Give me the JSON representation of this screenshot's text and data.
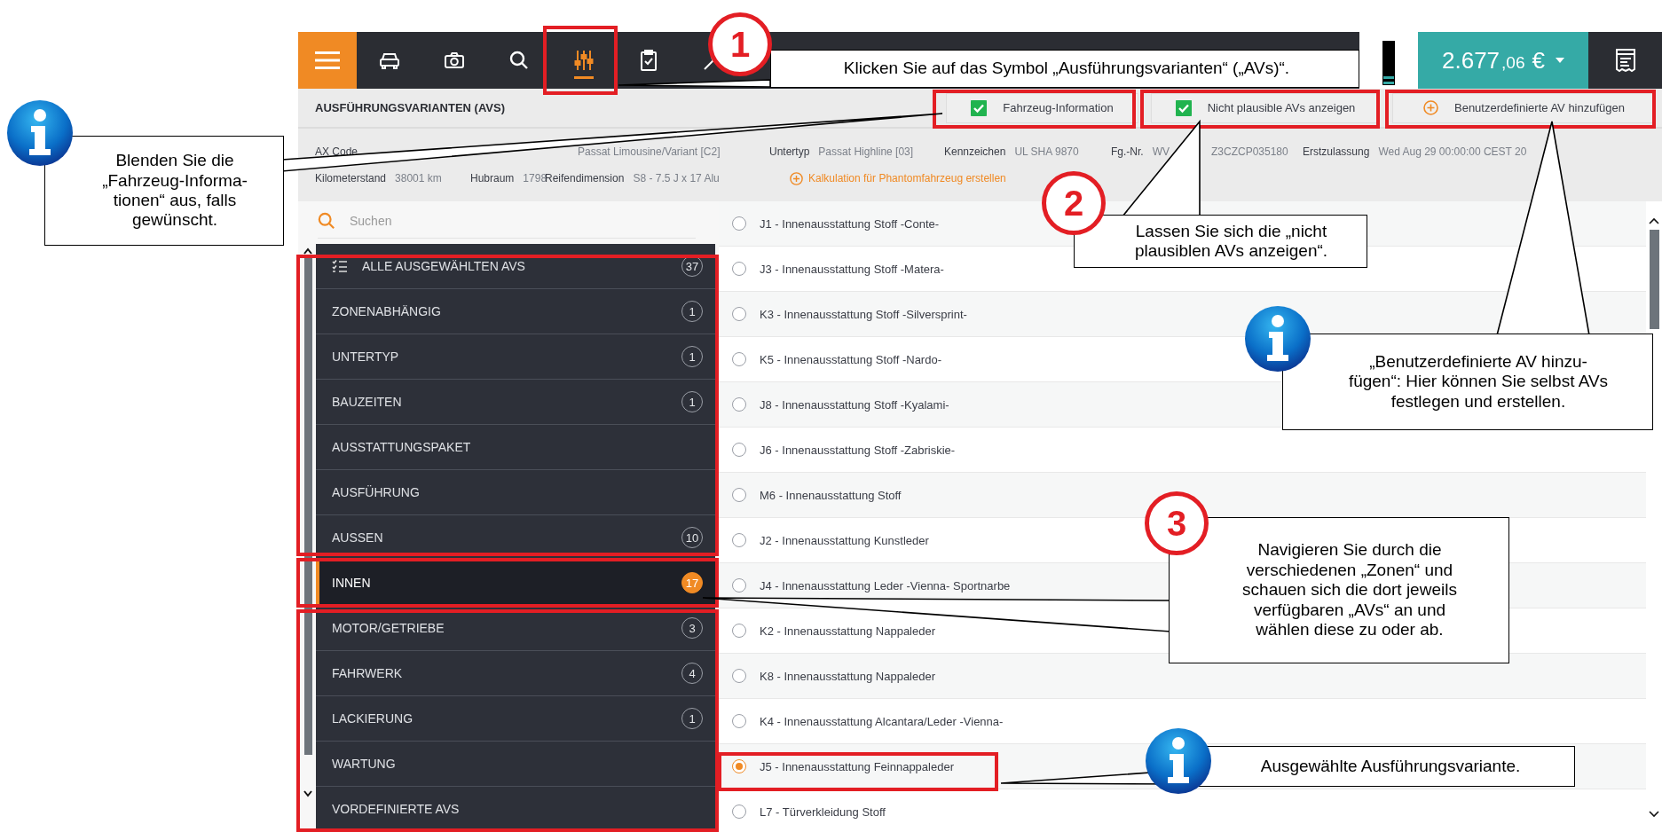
{
  "toolbar": {
    "tabs": [
      {
        "selected": false
      },
      {
        "selected": false
      },
      {
        "selected": false
      },
      {
        "selected": true
      },
      {
        "selected": false
      },
      {
        "selected": false
      }
    ],
    "total": {
      "amount": "2.677",
      "cents": ",06",
      "currency": "€"
    }
  },
  "page_title": "AUSFÜHRUNGSVARIANTEN (AVS)",
  "toggles": [
    {
      "kind": "checkbox",
      "label": "Fahrzeug-Information",
      "checked": true
    },
    {
      "kind": "checkbox",
      "label": "Nicht plausible AVs anzeigen",
      "checked": true
    },
    {
      "kind": "action",
      "label": "Benutzerdefinierte AV hinzufügen"
    }
  ],
  "vehicle_info": {
    "row_1": [
      {
        "label": "AX Code"
      },
      {
        "value": "Passat Limousine/Variant [C2]"
      },
      {
        "label": "Untertyp",
        "value": "Passat Highline [03]"
      },
      {
        "label": "Kennzeichen",
        "value": "UL SHA 9870"
      },
      {
        "label": "Fg.-Nr.",
        "value": "WV"
      },
      {
        "value": "Z3CZCP035180"
      },
      {
        "label": "Erstzulassung",
        "value": "Wed Aug 29 00:00:00 CEST 20"
      }
    ],
    "row_2": [
      {
        "label": "Kilometerstand",
        "value": "38001 km"
      },
      {
        "label": "Hubraum",
        "value": "1798"
      },
      {
        "label": "Reifendimension",
        "value": "S8 - 7.5 J x 17 Alu"
      }
    ],
    "link": "Kalkulation für Phantomfahrzeug erstellen"
  },
  "search": {
    "placeholder": "Suchen"
  },
  "zones": [
    {
      "label": "ALLE AUSGEWÄHLTEN AVS",
      "count": "37",
      "selected": false
    },
    {
      "label": "ZONENABHÄNGIG",
      "count": "1",
      "selected": false
    },
    {
      "label": "UNTERTYP",
      "count": "1",
      "selected": false
    },
    {
      "label": "BAUZEITEN",
      "count": "1",
      "selected": false
    },
    {
      "label": "AUSSTATTUNGSPAKET",
      "selected": false
    },
    {
      "label": "AUSFÜHRUNG",
      "selected": false
    },
    {
      "label": "AUSSEN",
      "count": "10",
      "selected": false
    },
    {
      "label": "INNEN",
      "count": "17",
      "selected": true
    },
    {
      "label": "MOTOR/GETRIEBE",
      "count": "3",
      "selected": false
    },
    {
      "label": "FAHRWERK",
      "count": "4",
      "selected": false
    },
    {
      "label": "LACKIERUNG",
      "count": "1",
      "selected": false
    },
    {
      "label": "WARTUNG",
      "selected": false
    },
    {
      "label": "VORDEFINIERTE AVS",
      "selected": false
    }
  ],
  "variants": [
    {
      "label": "J1 - Innenausstattung Stoff -Conte-",
      "selected": false
    },
    {
      "label": "J3 - Innenausstattung Stoff -Matera-",
      "selected": false
    },
    {
      "label": "K3 - Innenausstattung Stoff -Silversprint-",
      "selected": false
    },
    {
      "label": "K5 - Innenausstattung Stoff -Nardo-",
      "selected": false
    },
    {
      "label": "J8 - Innenausstattung Stoff -Kyalami-",
      "selected": false
    },
    {
      "label": "J6 - Innenausstattung Stoff -Zabriskie-",
      "selected": false
    },
    {
      "label": "M6 - Innenausstattung Stoff",
      "selected": false
    },
    {
      "label": "J2 - Innenausstattung Kunstleder",
      "selected": false
    },
    {
      "label": "J4 - Innenausstattung Leder -Vienna- Sportnarbe",
      "selected": false
    },
    {
      "label": "K2 - Innenausstattung Nappaleder",
      "selected": false
    },
    {
      "label": "K8 - Innenausstattung Nappaleder",
      "selected": false
    },
    {
      "label": "K4 - Innenausstattung Alcantara/Leder -Vienna-",
      "selected": false
    },
    {
      "label": "J5 - Innenausstattung Feinnappaleder",
      "selected": true
    },
    {
      "label": "L7 - Türverkleidung Stoff",
      "selected": false
    }
  ],
  "callouts": [
    {
      "kind": "number",
      "number": "1",
      "lines": [
        "Klicken Sie auf das Symbol „Ausführungsvarianten“ („AVs)“."
      ]
    },
    {
      "kind": "info",
      "lines": [
        "Blenden Sie die",
        "„Fahrzeug-Informa-",
        "tionen“ aus, falls",
        "gewünscht."
      ]
    },
    {
      "kind": "number",
      "number": "2",
      "lines": [
        "Lassen Sie sich die „nicht",
        "plausiblen AVs anzeigen“."
      ]
    },
    {
      "kind": "info",
      "lines": [
        "„Benutzerdefinierte AV hinzu-",
        "fügen“: Hier können Sie selbst AVs",
        "festlegen und erstellen."
      ]
    },
    {
      "kind": "number",
      "number": "3",
      "lines": [
        "Navigieren Sie durch die",
        "verschiedenen „Zonen“ und",
        "schauen sich die dort jeweils",
        "verfügbaren „AVs“ an und",
        "wählen diese zu oder ab."
      ]
    },
    {
      "kind": "info",
      "lines": [
        "Ausgewählte Ausführungsvariante."
      ]
    }
  ]
}
